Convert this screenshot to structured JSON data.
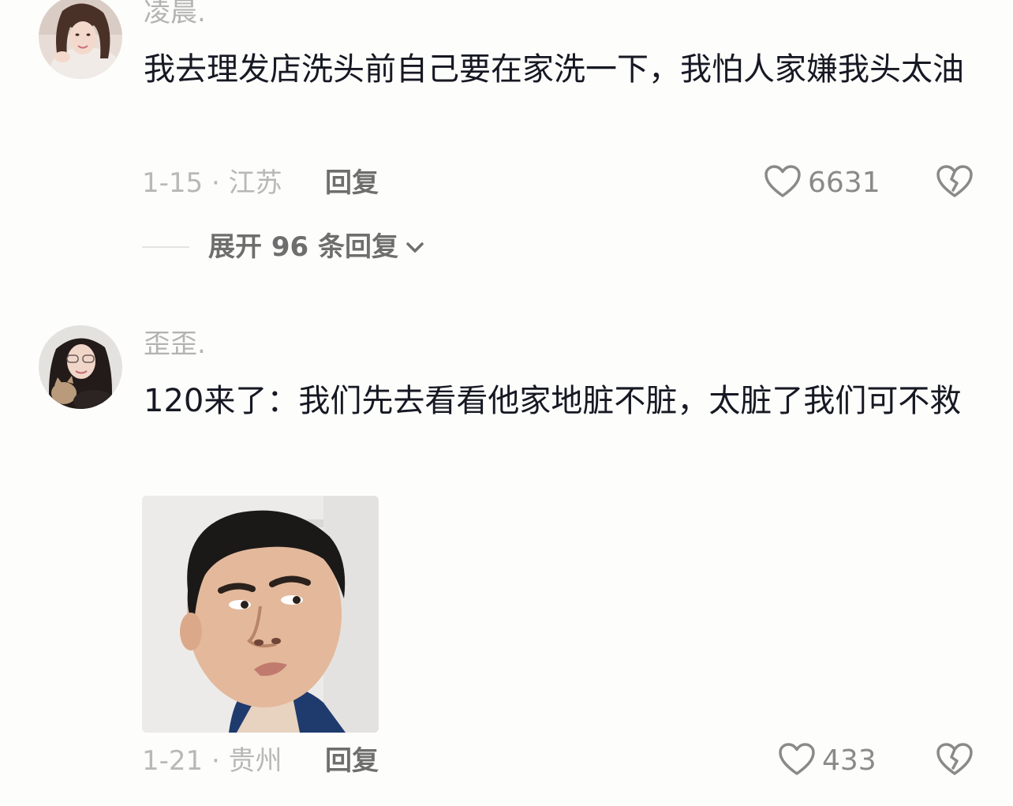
{
  "comments": [
    {
      "username": "凌晨.",
      "text": "我去理发店洗头前自己要在家洗一下，我怕人家嫌我头太油",
      "date_location": "1-15 · 江苏",
      "reply_label": "回复",
      "like_count": "6631",
      "expand_label": "展开 96 条回复"
    },
    {
      "username": "歪歪.",
      "text": "120来了：我们先去看看他家地脏不脏，太脏了我们可不救",
      "date_location": "1-21 · 贵州",
      "reply_label": "回复",
      "like_count": "433"
    }
  ],
  "icons": {
    "like": "heart-outline-icon",
    "dislike": "broken-heart-icon",
    "expand": "chevron-down-icon"
  },
  "colors": {
    "background": "#fdfdfb",
    "text_primary": "#161823",
    "text_muted": "#b3b3b3",
    "text_secondary": "#6e6e6e"
  }
}
